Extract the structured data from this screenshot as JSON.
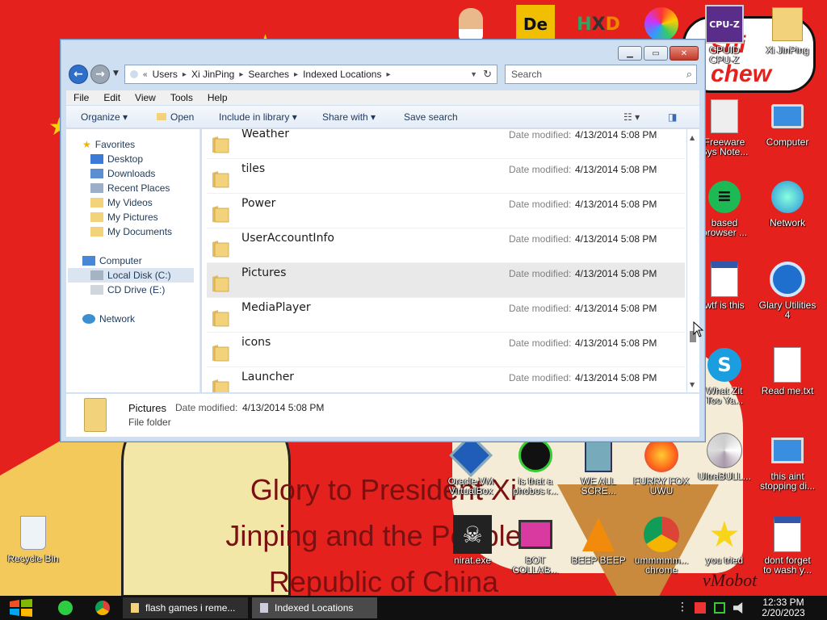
{
  "wallpaper": {
    "slogan": "Glory to President Xi\nJinping and the People's\nRepublic of China",
    "cloud_text": "shi\nchew",
    "signature": "vMobot"
  },
  "desktop_icons": [
    {
      "label": "",
      "icon": "user-icon"
    },
    {
      "label": "",
      "icon": "de-app-icon"
    },
    {
      "label": "",
      "icon": "hxd-icon"
    },
    {
      "label": "",
      "icon": "color-wheel-icon"
    },
    {
      "label": "CPUID\nCPU-Z",
      "icon": "cpu-z-icon"
    },
    {
      "label": "Xi JinPing",
      "icon": "user-folder-icon"
    },
    {
      "label": "Freeware\nSys Note...",
      "icon": "document-icon"
    },
    {
      "label": "Computer",
      "icon": "computer-icon"
    },
    {
      "label": "based\nbrowser ...",
      "icon": "browser-icon"
    },
    {
      "label": "Network",
      "icon": "network-icon"
    },
    {
      "label": "wtf is this",
      "icon": "window-doc-icon"
    },
    {
      "label": "Glary Utilities\n4",
      "icon": "glary-icon"
    },
    {
      "label": "What Zit\nToo Ya...",
      "icon": "skype-icon"
    },
    {
      "label": "Read me.txt",
      "icon": "text-file-icon"
    },
    {
      "label": "Oracle VM\nVirtualBox",
      "icon": "virtualbox-icon"
    },
    {
      "label": "is that a\nphobos r...",
      "icon": "phobos-icon"
    },
    {
      "label": "WE ALL\nSCRE...",
      "icon": "scream-icon"
    },
    {
      "label": "FURRY FOX\nUWU",
      "icon": "firefox-icon"
    },
    {
      "label": "UltraBULL...",
      "icon": "disc-icon"
    },
    {
      "label": "this aint\nstopping di...",
      "icon": "computer-cd-icon"
    },
    {
      "label": "Recycle Bin",
      "icon": "recycle-bin-icon"
    },
    {
      "label": "nirat.exe",
      "icon": "skull-icon"
    },
    {
      "label": "BOT\nCOLLAB...",
      "icon": "bot-monitor-icon"
    },
    {
      "label": "BEEP BEEP",
      "icon": "vlc-icon"
    },
    {
      "label": "ummmmm...\nchrome",
      "icon": "chrome-icon"
    },
    {
      "label": "you tried",
      "icon": "star-icon"
    },
    {
      "label": "dont forget\nto wash y...",
      "icon": "window-doc-icon"
    }
  ],
  "window": {
    "breadcrumb": [
      "Users",
      "Xi JinPing",
      "Searches",
      "Indexed Locations"
    ],
    "search_placeholder": "Search",
    "menu": [
      "File",
      "Edit",
      "View",
      "Tools",
      "Help"
    ],
    "toolbar": {
      "organize": "Organize",
      "open": "Open",
      "include": "Include in library",
      "share": "Share with",
      "save_search": "Save search"
    },
    "nav": {
      "favorites": "Favorites",
      "fav_items": [
        "Desktop",
        "Downloads",
        "Recent Places",
        "My Videos",
        "My Pictures",
        "My Documents"
      ],
      "computer": "Computer",
      "computer_items": [
        "Local Disk (C:)",
        "CD Drive (E:)"
      ],
      "network": "Network"
    },
    "date_label": "Date modified:",
    "files": [
      {
        "name": "Weather",
        "date": "4/13/2014 5:08 PM"
      },
      {
        "name": "tiles",
        "date": "4/13/2014 5:08 PM"
      },
      {
        "name": "Power",
        "date": "4/13/2014 5:08 PM"
      },
      {
        "name": "UserAccountInfo",
        "date": "4/13/2014 5:08 PM"
      },
      {
        "name": "Pictures",
        "date": "4/13/2014 5:08 PM"
      },
      {
        "name": "MediaPlayer",
        "date": "4/13/2014 5:08 PM"
      },
      {
        "name": "icons",
        "date": "4/13/2014 5:08 PM"
      },
      {
        "name": "Launcher",
        "date": "4/13/2014 5:08 PM"
      }
    ],
    "details": {
      "name": "Pictures",
      "date_label": "Date modified:",
      "date": "4/13/2014 5:08 PM",
      "type": "File folder"
    }
  },
  "taskbar": {
    "tasks": [
      "flash games i reme...",
      "Indexed Locations"
    ],
    "time": "12:33 PM",
    "date": "2/20/2023"
  },
  "colors": {
    "wallpaper": "#e4211d",
    "folder": "#f2d27a",
    "accent": "#3b7ad6"
  }
}
